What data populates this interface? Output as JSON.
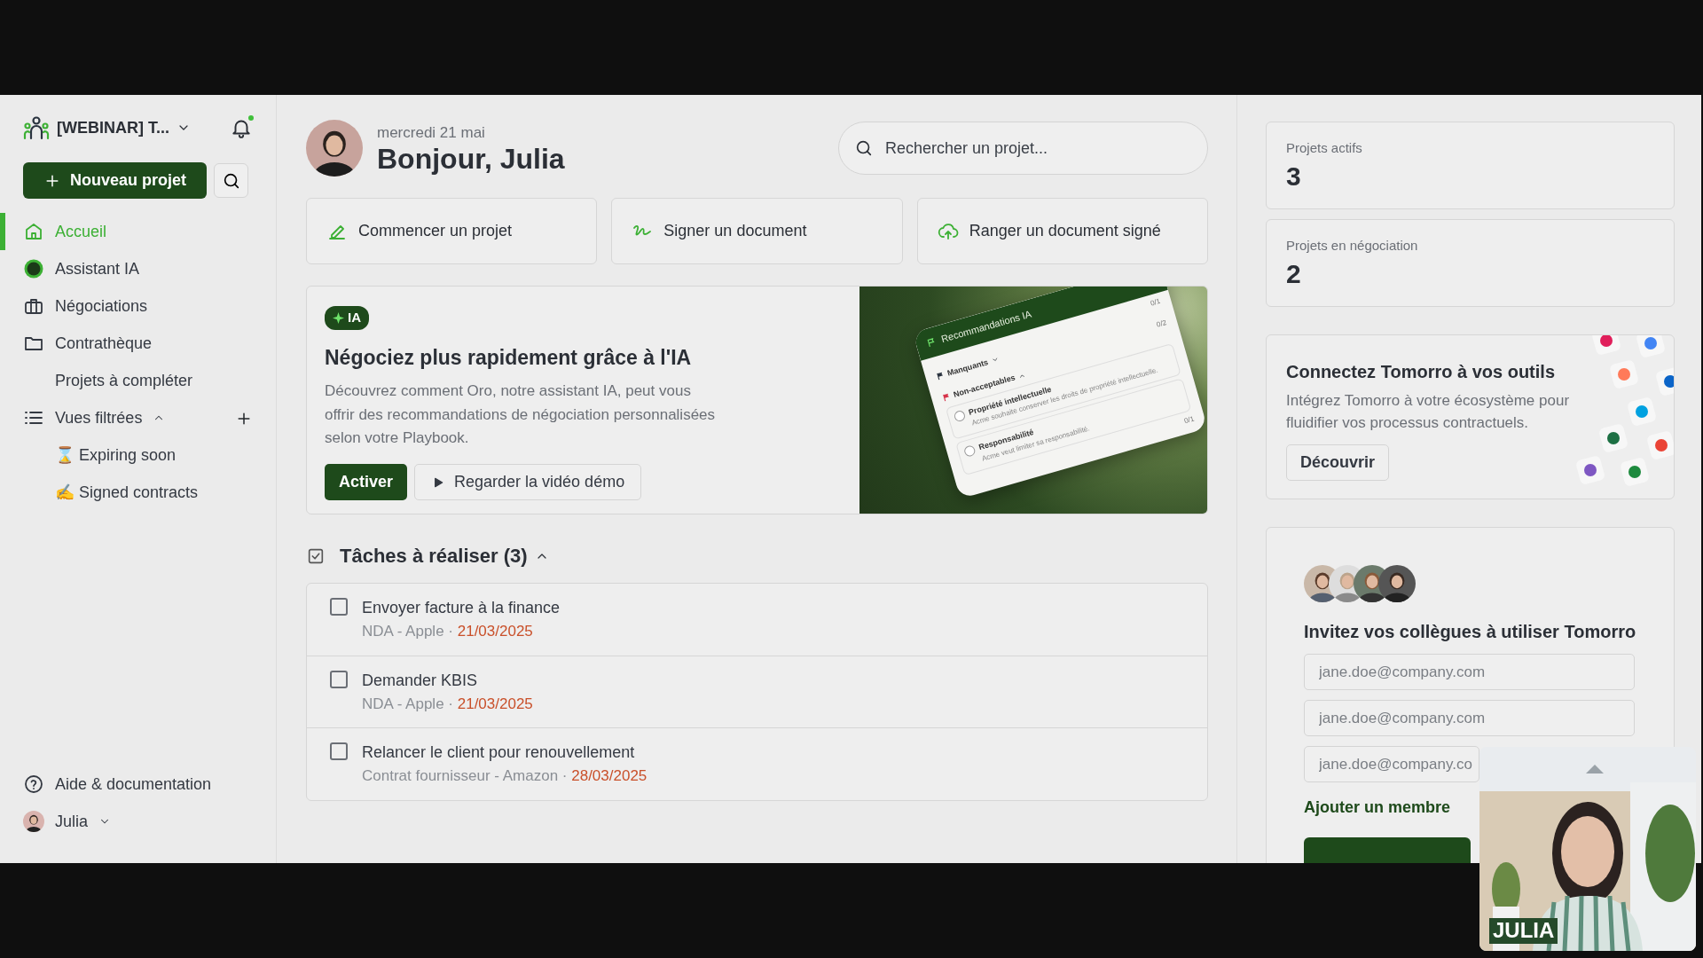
{
  "sidebar": {
    "workspace": "[WEBINAR] T...",
    "notifications_unread": true,
    "new_project": "Nouveau projet",
    "nav": [
      {
        "label": "Accueil",
        "kind": "home",
        "selected": true
      },
      {
        "label": "Assistant IA",
        "kind": "assistant",
        "selected": false
      },
      {
        "label": "Négociations",
        "kind": "negotiations",
        "selected": false
      },
      {
        "label": "Contrathèque",
        "kind": "library",
        "selected": false
      },
      {
        "label": "Projets à compléter",
        "kind": "sub",
        "selected": false
      }
    ],
    "filtered_views": {
      "label": "Vues filtrées",
      "expanded": true,
      "items": [
        {
          "label": "⌛ Expiring soon",
          "selected": false
        },
        {
          "label": "✍ Signed contracts",
          "selected": false
        }
      ]
    },
    "help": "Aide & documentation",
    "user": "Julia"
  },
  "header": {
    "date": "mercredi 21 mai",
    "greeting": "Bonjour, Julia",
    "search": {
      "placeholder": "Rechercher un projet..."
    }
  },
  "quick_actions": [
    {
      "label": "Commencer un projet",
      "kind": "start"
    },
    {
      "label": "Signer un document",
      "kind": "sign"
    },
    {
      "label": "Ranger un document signé",
      "kind": "upload"
    }
  ],
  "promo": {
    "badge": "IA",
    "title": "Négociez plus rapidement grâce à l'IA",
    "text": "Découvrez comment Oro, notre assistant IA, peut vous offrir des recommandations de négociation personnalisées selon votre Playbook.",
    "primary": "Activer",
    "secondary": "Regarder la vidéo démo",
    "preview": {
      "title": "Recommandations IA",
      "sections": [
        {
          "label": "Manquants",
          "count": "0/1",
          "expanded": false,
          "color": "#2b3440"
        },
        {
          "label": "Non-acceptables",
          "count": "0/2",
          "expanded": true,
          "color": "#d6334a",
          "items": [
            {
              "title": "Propriété intellectuelle",
              "text": "Acme souhaite conserver les droits de propriété intellectuelle.",
              "checked": false
            },
            {
              "title": "Responsabilité",
              "text": "Acme veut limiter sa responsabilité.",
              "checked": false
            }
          ]
        }
      ],
      "footer_count": "0/1"
    }
  },
  "tasks": {
    "title": "Tâches à réaliser (3)",
    "expanded": true,
    "items": [
      {
        "title": "Envoyer facture à la finance",
        "meta": "NDA - Apple ·",
        "due": "21/03/2025",
        "checked": false
      },
      {
        "title": "Demander KBIS",
        "meta": "NDA - Apple ·",
        "due": "21/03/2025",
        "checked": false
      },
      {
        "title": "Relancer le client pour renouvellement",
        "meta": "Contrat fournisseur - Amazon ·",
        "due": "28/03/2025",
        "checked": false
      }
    ]
  },
  "stats": [
    {
      "label": "Projets actifs",
      "value": "3"
    },
    {
      "label": "Projets en négociation",
      "value": "2"
    }
  ],
  "integrations": {
    "title": "Connectez Tomorro à vos outils",
    "text": "Intégrez Tomorro à votre écosystème pour fluidifier vos processus contractuels.",
    "button": "Découvrir"
  },
  "invite": {
    "title": "Invitez vos collègues à utiliser Tomorro",
    "fields": [
      {
        "placeholder": "jane.doe@company.com"
      },
      {
        "placeholder": "jane.doe@company.com"
      },
      {
        "placeholder": "jane.doe@company.co"
      }
    ],
    "add": "Ajouter un membre"
  },
  "video": {
    "kind": "picture",
    "caption": "JULIA"
  }
}
